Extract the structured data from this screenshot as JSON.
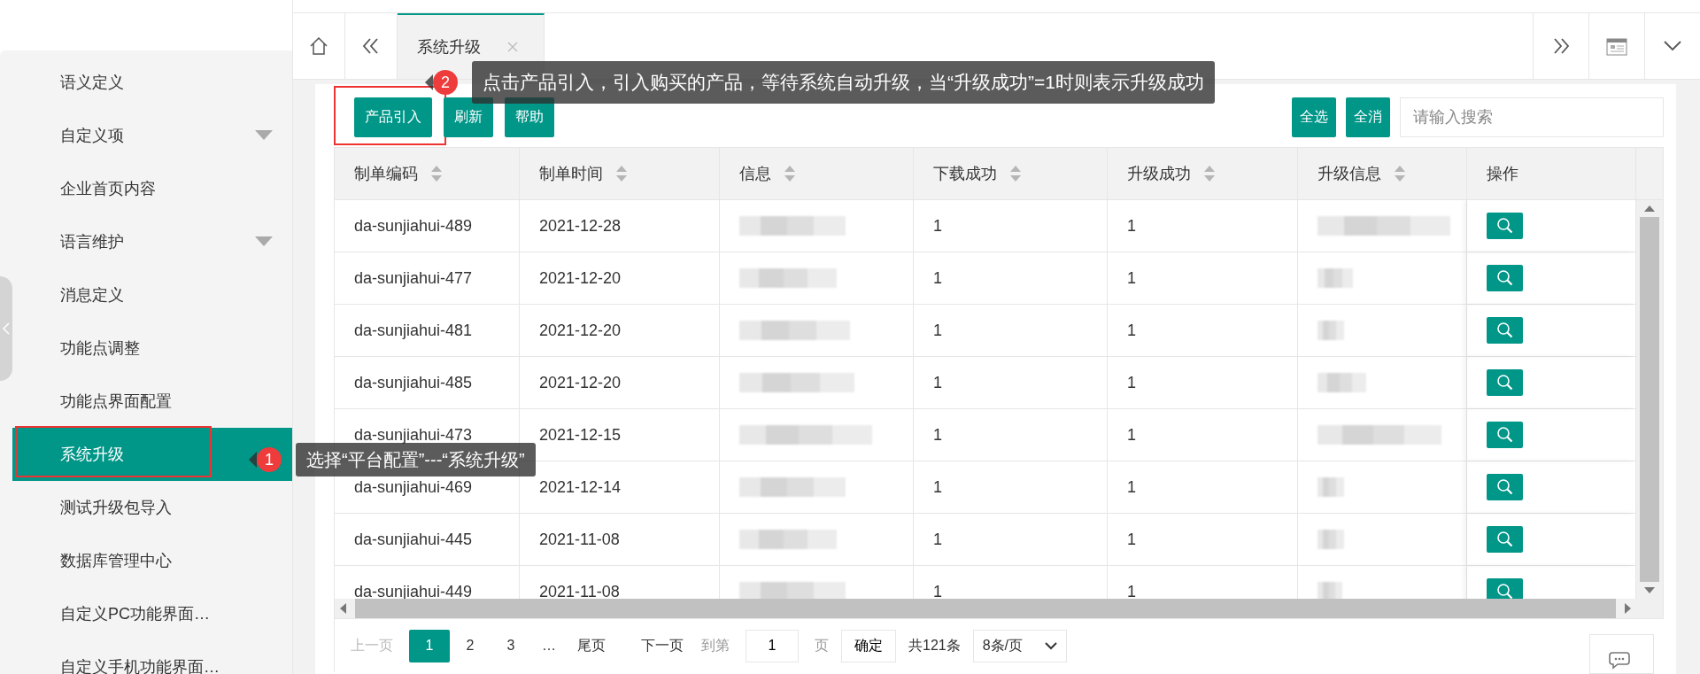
{
  "sidebar": {
    "items": [
      {
        "label": "语义定义",
        "has_submenu": false,
        "selected": false
      },
      {
        "label": "自定义项",
        "has_submenu": true,
        "selected": false
      },
      {
        "label": "企业首页内容",
        "has_submenu": false,
        "selected": false
      },
      {
        "label": "语言维护",
        "has_submenu": true,
        "selected": false
      },
      {
        "label": "消息定义",
        "has_submenu": false,
        "selected": false
      },
      {
        "label": "功能点调整",
        "has_submenu": false,
        "selected": false
      },
      {
        "label": "功能点界面配置",
        "has_submenu": false,
        "selected": false
      },
      {
        "label": "系统升级",
        "has_submenu": false,
        "selected": true,
        "highlighted": true,
        "callout": {
          "number": "1",
          "text": "选择“平台配置”---“系统升级”"
        }
      },
      {
        "label": "测试升级包导入",
        "has_submenu": false,
        "selected": false
      },
      {
        "label": "数据库管理中心",
        "has_submenu": false,
        "selected": false
      },
      {
        "label": "自定义PC功能界面…",
        "has_submenu": false,
        "selected": false
      },
      {
        "label": "自定义手机功能界面…",
        "has_submenu": false,
        "selected": false
      }
    ]
  },
  "tabs": [
    {
      "label": "系统升级",
      "selected": true
    }
  ],
  "toolbar": {
    "buttons": [
      {
        "label": "产品引入",
        "highlighted": true,
        "callout": {
          "number": "2",
          "text": "点击产品引入，引入购买的产品，等待系统自动升级，当“升级成功”=1时则表示升级成功"
        }
      },
      {
        "label": "刷新",
        "highlighted": false
      },
      {
        "label": "帮助",
        "highlighted": false
      }
    ],
    "right_buttons": [
      "全选",
      "全消"
    ],
    "search": {
      "placeholder": "请输入搜索"
    }
  },
  "table": {
    "columns": [
      {
        "label": "制单编码",
        "sortable": true
      },
      {
        "label": "制单时间",
        "sortable": true
      },
      {
        "label": "信息",
        "sortable": true
      },
      {
        "label": "下载成功",
        "sortable": true
      },
      {
        "label": "升级成功",
        "sortable": true
      },
      {
        "label": "升级信息",
        "sortable": true
      },
      {
        "label": "操作",
        "sortable": false
      }
    ],
    "rows": [
      {
        "code": "da-sunjiahui-489",
        "date": "2021-12-28",
        "info_redacted": true,
        "download_success": "1",
        "upgrade_success": "1",
        "upgrade_info_redacted": true
      },
      {
        "code": "da-sunjiahui-477",
        "date": "2021-12-20",
        "info_redacted": true,
        "download_success": "1",
        "upgrade_success": "1",
        "upgrade_info_redacted": true
      },
      {
        "code": "da-sunjiahui-481",
        "date": "2021-12-20",
        "info_redacted": true,
        "download_success": "1",
        "upgrade_success": "1",
        "upgrade_info_redacted": true
      },
      {
        "code": "da-sunjiahui-485",
        "date": "2021-12-20",
        "info_redacted": true,
        "download_success": "1",
        "upgrade_success": "1",
        "upgrade_info_redacted": true
      },
      {
        "code": "da-sunjiahui-473",
        "date": "2021-12-15",
        "info_redacted": true,
        "download_success": "1",
        "upgrade_success": "1",
        "upgrade_info_redacted": true
      },
      {
        "code": "da-sunjiahui-469",
        "date": "2021-12-14",
        "info_redacted": true,
        "download_success": "1",
        "upgrade_success": "1",
        "upgrade_info_redacted": true
      },
      {
        "code": "da-sunjiahui-445",
        "date": "2021-11-08",
        "info_redacted": true,
        "download_success": "1",
        "upgrade_success": "1",
        "upgrade_info_redacted": true
      },
      {
        "code": "da-sunjiahui-449",
        "date": "2021-11-08",
        "info_redacted": true,
        "download_success": "1",
        "upgrade_success": "1",
        "upgrade_info_redacted": true
      }
    ]
  },
  "pagination": {
    "prev": "上一页",
    "pages": [
      {
        "label": "1",
        "selected": true
      },
      {
        "label": "2",
        "selected": false
      },
      {
        "label": "3",
        "selected": false
      }
    ],
    "ellipsis": "…",
    "last": "尾页",
    "next": "下一页",
    "goto_label": "到第",
    "goto_value": "1",
    "page_unit": "页",
    "confirm": "确定",
    "total": "共121条",
    "page_size": "8条/页"
  }
}
